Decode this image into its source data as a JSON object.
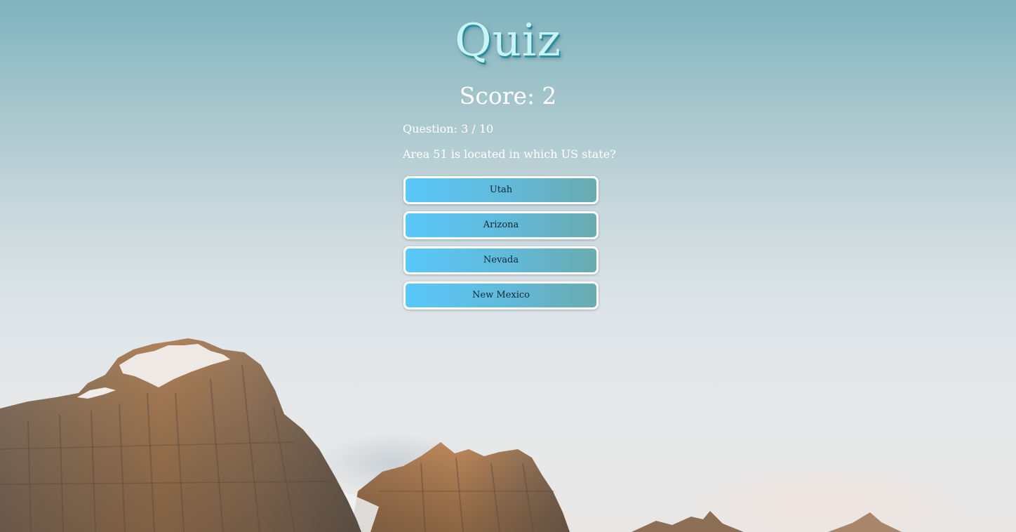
{
  "quiz": {
    "title": "Quiz",
    "score_label": "Score:",
    "score_value": "2",
    "progress_label": "Question:",
    "progress_current": "3",
    "progress_separator": "/",
    "progress_total": "10",
    "question": "Area 51 is located in which US state?",
    "answers": [
      {
        "label": "Utah"
      },
      {
        "label": "Arizona"
      },
      {
        "label": "Nevada"
      },
      {
        "label": "New Mexico"
      }
    ]
  },
  "theme": {
    "title_color": "#c9f3f5",
    "button_gradient_start": "#5ac8fa",
    "button_gradient_end": "#6aabb0",
    "button_border": "#ffffff"
  },
  "background": {
    "subject": "mountain-landscape",
    "sky": "pale blue gradient"
  }
}
